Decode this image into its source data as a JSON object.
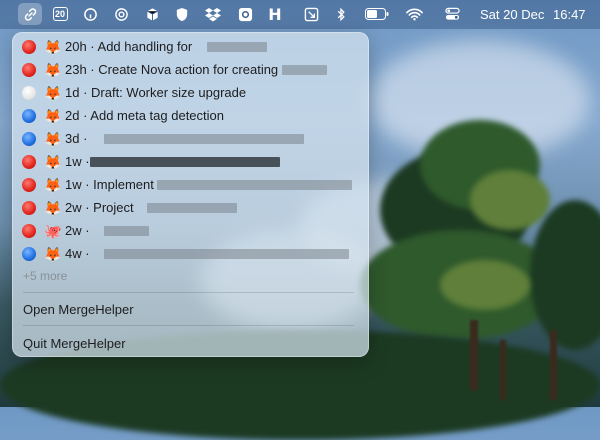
{
  "menubar": {
    "icons": [
      "link-icon",
      "calendar-icon",
      "finder-icon",
      "openai-icon",
      "box-icon",
      "shield-icon",
      "dropbox-icon",
      "gear-icon",
      "h-icon",
      "arrow-icon",
      "bluetooth-icon",
      "battery-icon",
      "wifi-icon",
      "control-center-icon"
    ],
    "calendar_day": "20",
    "date": "Sat 20 Dec",
    "time": "16:47"
  },
  "menu": {
    "items": [
      {
        "status": "red",
        "emoji": "🦊",
        "text": "20h · Add handling for"
      },
      {
        "status": "red",
        "emoji": "🦊",
        "text": "23h · Create Nova action for creating"
      },
      {
        "status": "white",
        "emoji": "🦊",
        "text": "1d · Draft: Worker size upgrade"
      },
      {
        "status": "blue",
        "emoji": "🦊",
        "text": "2d · Add meta tag detection"
      },
      {
        "status": "blue",
        "emoji": "🦊",
        "text": "3d ·"
      },
      {
        "status": "red",
        "emoji": "🦊",
        "text": "1w ·"
      },
      {
        "status": "red",
        "emoji": "🦊",
        "text": "1w · Implement"
      },
      {
        "status": "red",
        "emoji": "🦊",
        "text": "2w · Project"
      },
      {
        "status": "red",
        "emoji": "🐙",
        "text": "2w ·"
      },
      {
        "status": "blue",
        "emoji": "🦊",
        "text": "4w ·"
      }
    ],
    "more": "+5 more",
    "open_label": "Open MergeHelper",
    "quit_label": "Quit MergeHelper"
  },
  "colors": {
    "red": "#e0241d",
    "blue": "#1f6fe0",
    "white": "#e6e6e6"
  }
}
